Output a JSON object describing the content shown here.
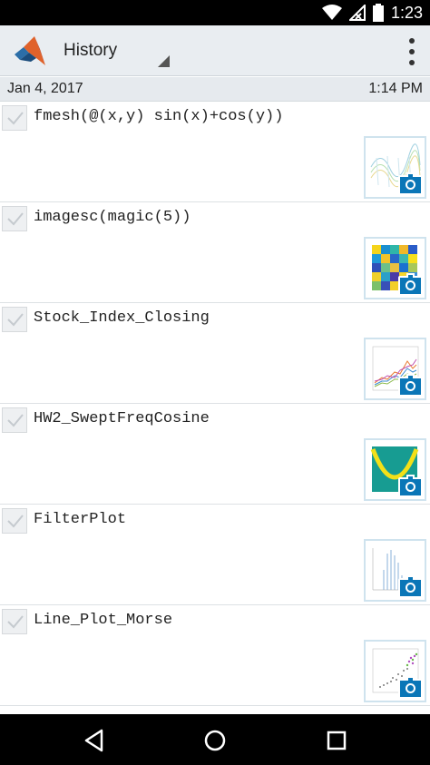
{
  "status_bar": {
    "time": "1:23",
    "icons": [
      "wifi-icon",
      "signal-off-icon",
      "battery-icon"
    ]
  },
  "app_bar": {
    "title": "History",
    "icons": [
      "matlab-logo",
      "dropdown-caret-icon",
      "overflow-menu-icon"
    ]
  },
  "date_header": {
    "date": "Jan 4, 2017",
    "time": "1:14 PM"
  },
  "history_items": [
    {
      "command": "fmesh(@(x,y) sin(x)+cos(y))",
      "thumbnail": "surface-mesh-plot"
    },
    {
      "command": "imagesc(magic(5))",
      "thumbnail": "color-grid-image"
    },
    {
      "command": "Stock_Index_Closing",
      "thumbnail": "multi-line-plot"
    },
    {
      "command": "HW2_SweptFreqCosine",
      "thumbnail": "spectrogram-plot"
    },
    {
      "command": "FilterPlot",
      "thumbnail": "bar-stem-plot"
    },
    {
      "command": "Line_Plot_Morse",
      "thumbnail": "scatter-plot"
    }
  ],
  "nav_bar": {
    "buttons": [
      "back-icon",
      "home-icon",
      "recents-icon"
    ]
  },
  "colors": {
    "app_bar_bg": "#e9edf1",
    "accent_blue": "#0a76b7",
    "status_bar_bg": "#000000"
  }
}
